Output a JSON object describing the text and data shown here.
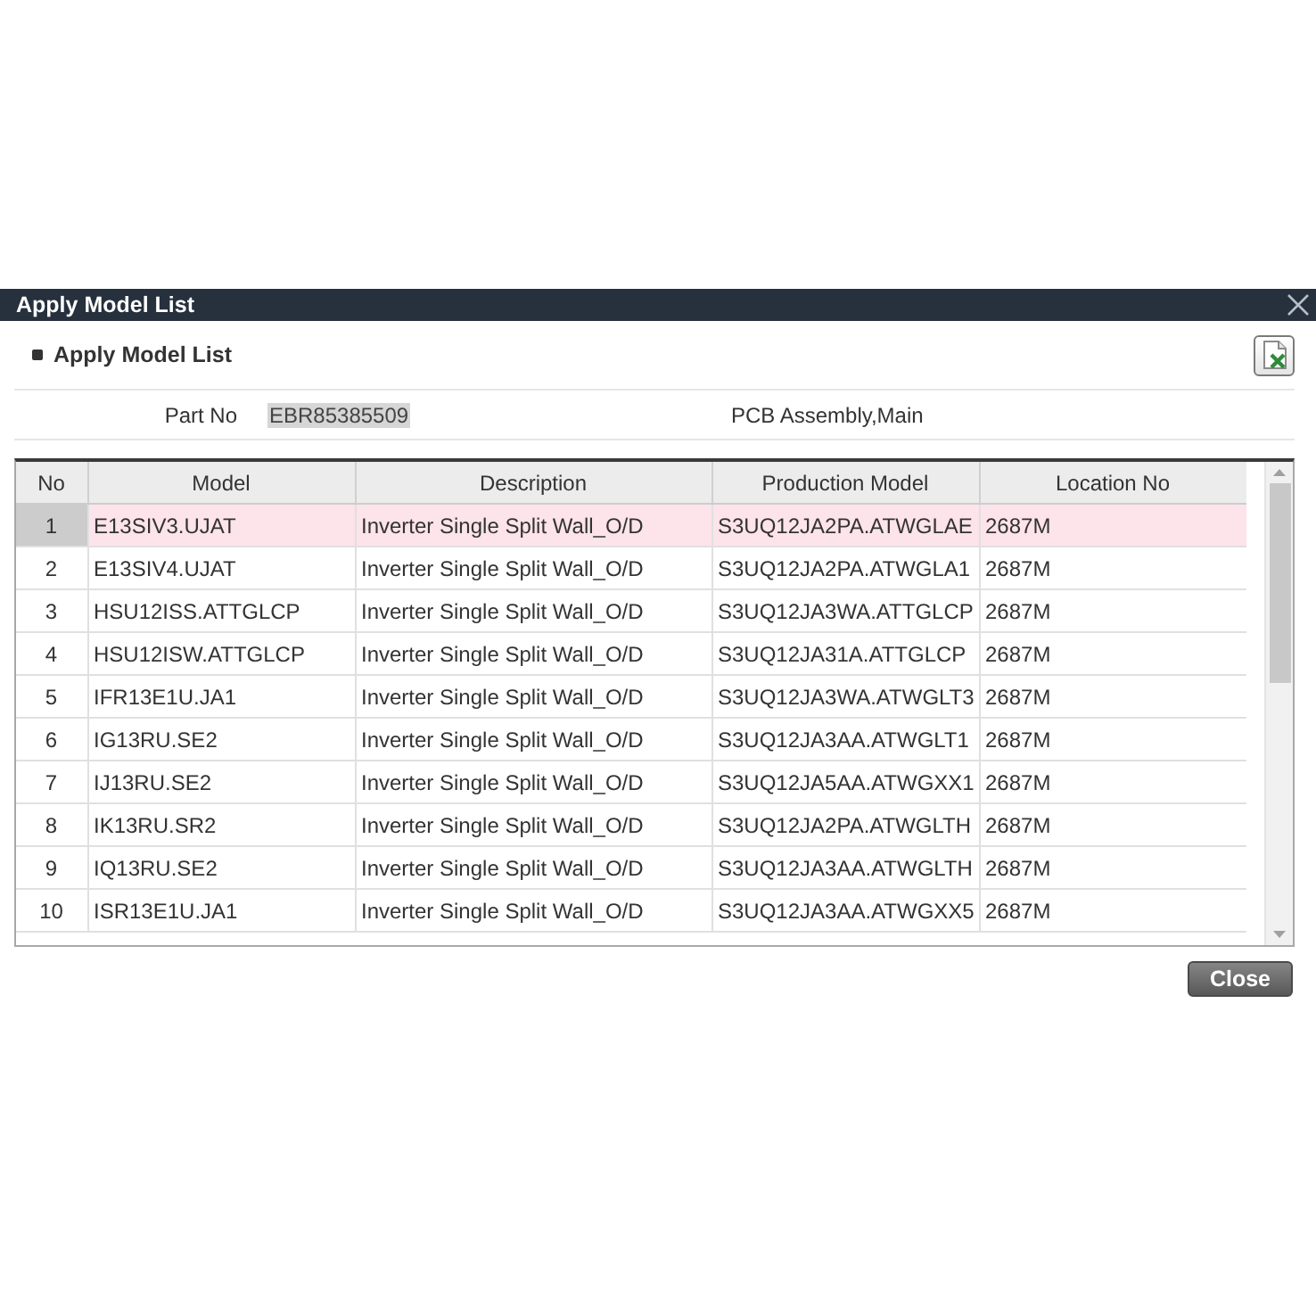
{
  "dialog": {
    "title": "Apply Model List"
  },
  "section": {
    "title": "Apply Model List"
  },
  "part": {
    "label": "Part No",
    "value": "EBR85385509",
    "description": "PCB Assembly,Main"
  },
  "table": {
    "columns": [
      "No",
      "Model",
      "Description",
      "Production Model",
      "Location No"
    ],
    "rows": [
      {
        "selected": true,
        "cells": [
          "1",
          "E13SIV3.UJAT",
          "Inverter Single Split Wall_O/D",
          "S3UQ12JA2PA.ATWGLAE",
          "2687M"
        ]
      },
      {
        "selected": false,
        "cells": [
          "2",
          "E13SIV4.UJAT",
          "Inverter Single Split Wall_O/D",
          "S3UQ12JA2PA.ATWGLA1",
          "2687M"
        ]
      },
      {
        "selected": false,
        "cells": [
          "3",
          "HSU12ISS.ATTGLCP",
          "Inverter Single Split Wall_O/D",
          "S3UQ12JA3WA.ATTGLCP",
          "2687M"
        ]
      },
      {
        "selected": false,
        "cells": [
          "4",
          "HSU12ISW.ATTGLCP",
          "Inverter Single Split Wall_O/D",
          "S3UQ12JA31A.ATTGLCP",
          "2687M"
        ]
      },
      {
        "selected": false,
        "cells": [
          "5",
          "IFR13E1U.JA1",
          "Inverter Single Split Wall_O/D",
          "S3UQ12JA3WA.ATWGLT3",
          "2687M"
        ]
      },
      {
        "selected": false,
        "cells": [
          "6",
          "IG13RU.SE2",
          "Inverter Single Split Wall_O/D",
          "S3UQ12JA3AA.ATWGLT1",
          "2687M"
        ]
      },
      {
        "selected": false,
        "cells": [
          "7",
          "IJ13RU.SE2",
          "Inverter Single Split Wall_O/D",
          "S3UQ12JA5AA.ATWGXX1",
          "2687M"
        ]
      },
      {
        "selected": false,
        "cells": [
          "8",
          "IK13RU.SR2",
          "Inverter Single Split Wall_O/D",
          "S3UQ12JA2PA.ATWGLTH",
          "2687M"
        ]
      },
      {
        "selected": false,
        "cells": [
          "9",
          "IQ13RU.SE2",
          "Inverter Single Split Wall_O/D",
          "S3UQ12JA3AA.ATWGLTH",
          "2687M"
        ]
      },
      {
        "selected": false,
        "cells": [
          "10",
          "ISR13E1U.JA1",
          "Inverter Single Split Wall_O/D",
          "S3UQ12JA3AA.ATWGXX5",
          "2687M"
        ]
      }
    ]
  },
  "buttons": [
    {
      "label": "Close"
    }
  ]
}
